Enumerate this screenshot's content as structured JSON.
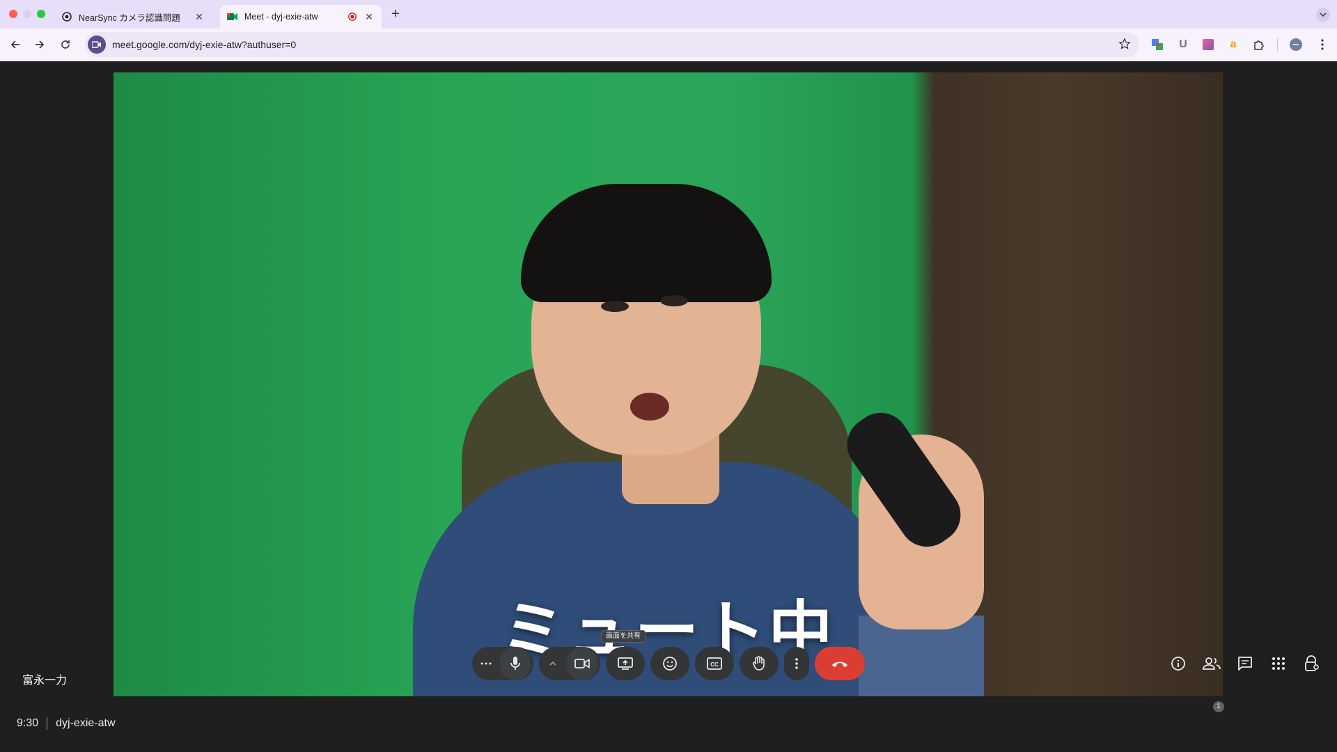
{
  "browser": {
    "tabs": [
      {
        "title": "NearSync カメラ認識問題",
        "favicon": "nearsync-icon",
        "active": false
      },
      {
        "title": "Meet - dyj-exie-atw",
        "favicon": "google-meet-icon",
        "active": true,
        "recording": true
      }
    ],
    "url": "meet.google.com/dyj-exie-atw?authuser=0",
    "extension_icons": [
      "google-translate-icon",
      "u-extension-icon",
      "gradient-extension-icon",
      "amazon-icon",
      "puzzle-extensions-icon"
    ]
  },
  "meeting": {
    "video_caption": "ミュート中",
    "self_name": "富永一力",
    "time": "9:30",
    "meeting_code": "dyj-exie-atw",
    "share_tooltip": "画面を共有",
    "participant_count": "1"
  },
  "colors": {
    "tabbar_bg": "#e7defa",
    "toolbar_bg": "#f7f2fc",
    "meet_bg": "#1f1f1f",
    "control_bg": "#333537",
    "leave_red": "#dc3d32"
  }
}
